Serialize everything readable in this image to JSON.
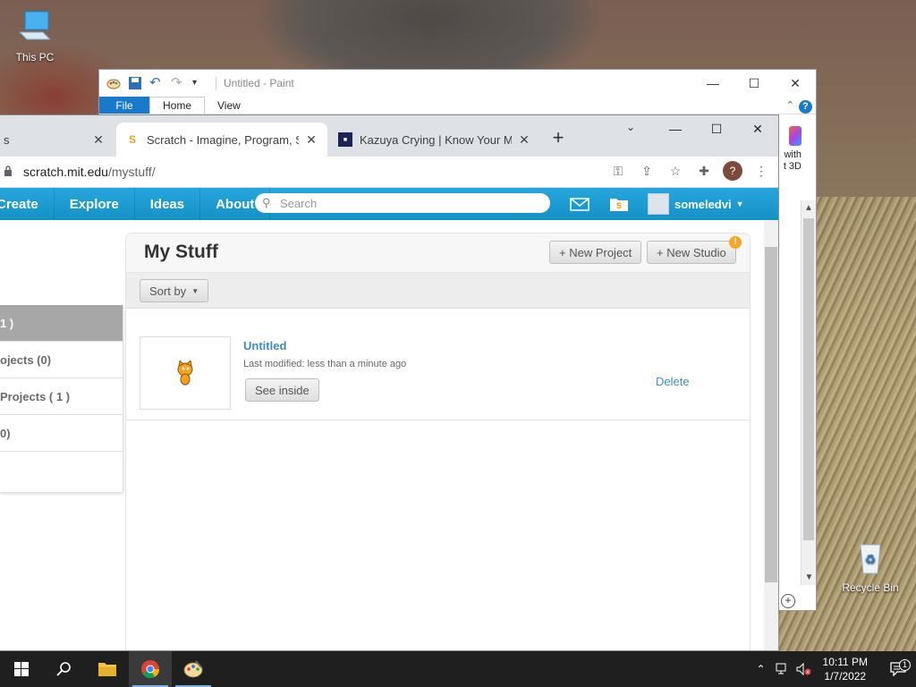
{
  "desktop": {
    "icons": [
      {
        "label": "This PC",
        "icon": "computer-icon"
      },
      {
        "label": "Recycle Bin",
        "icon": "recycle-bin-icon"
      }
    ]
  },
  "paint": {
    "title": "Untitled - Paint",
    "tabs": [
      "File",
      "Home",
      "View"
    ],
    "side_text": "with\nt 3D",
    "help": "?"
  },
  "browser": {
    "tabs": [
      {
        "title": "s",
        "active": false
      },
      {
        "title": "Scratch - Imagine, Program, Sha",
        "active": true
      },
      {
        "title": "Kazuya Crying | Know Your Mem",
        "active": false
      }
    ],
    "url_host": "scratch.mit.edu",
    "url_path": "/mystuff/",
    "profile_initial": "?"
  },
  "scratch": {
    "nav": [
      "Create",
      "Explore",
      "Ideas",
      "About"
    ],
    "search_placeholder": "Search",
    "username": "someledvi",
    "page_title": "My Stuff",
    "new_project": "+ New Project",
    "new_studio": "+ New Studio",
    "alert_badge": "!",
    "sort_by": "Sort by",
    "sidebar": [
      {
        "label": "1 )",
        "active": true
      },
      {
        "label": "ojects (0)",
        "active": false
      },
      {
        "label": "Projects ( 1 )",
        "active": false
      },
      {
        "label": "0)",
        "active": false
      }
    ],
    "project": {
      "title": "Untitled",
      "modified": "Last modified: less than a minute ago",
      "see_inside": "See inside",
      "delete": "Delete"
    }
  },
  "taskbar": {
    "time": "10:11 PM",
    "date": "1/7/2022",
    "notification_count": "1"
  }
}
